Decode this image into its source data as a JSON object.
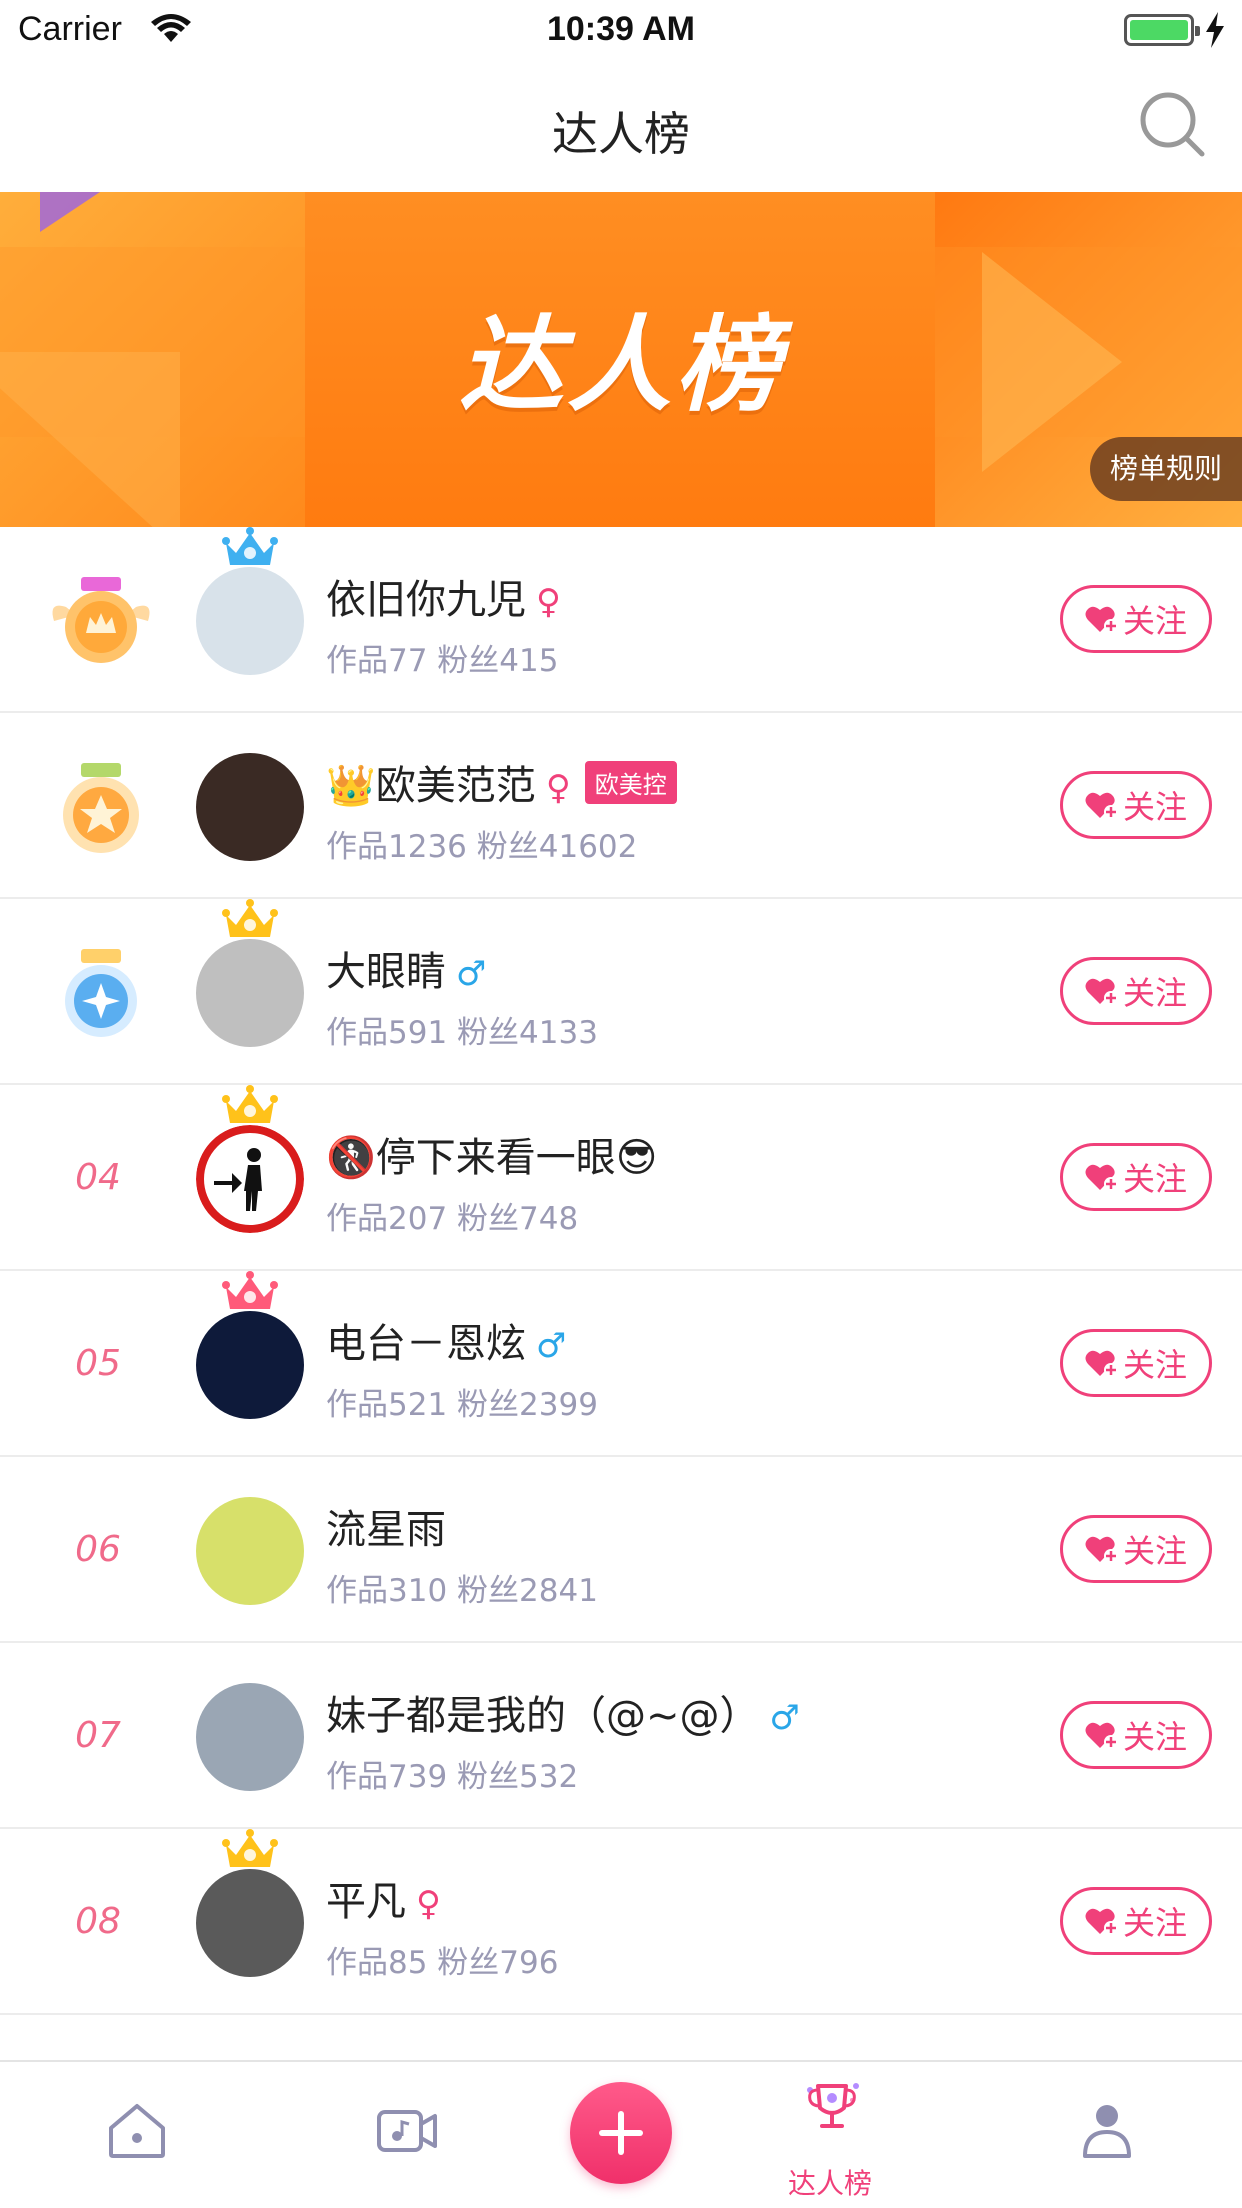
{
  "status_bar": {
    "carrier": "Carrier",
    "time": "10:39 AM"
  },
  "nav": {
    "title": "达人榜"
  },
  "banner": {
    "title": "达人榜",
    "rules_label": "榜单规则"
  },
  "rows": [
    {
      "rank": "",
      "medal": "gold-medal",
      "name": "依旧你九児",
      "gender": "♀",
      "tag": "",
      "stats": "作品77 粉丝415",
      "crown": "blue",
      "follow": "关注",
      "avatar_color": "#d8e2ea"
    },
    {
      "rank": "",
      "medal": "silver-medal",
      "name": "👑欧美范范",
      "gender": "♀",
      "tag": "欧美控",
      "stats": "作品1236 粉丝41602",
      "crown": "",
      "follow": "关注",
      "avatar_color": "#3a2a24"
    },
    {
      "rank": "",
      "medal": "bronze-medal",
      "name": "大眼睛",
      "gender": "♂",
      "tag": "",
      "stats": "作品591 粉丝4133",
      "crown": "gold",
      "follow": "关注",
      "avatar_color": "#bfbfbf"
    },
    {
      "rank": "04",
      "medal": "",
      "name": "🚷停下来看一眼😎",
      "gender": "",
      "tag": "",
      "stats": "作品207 粉丝748",
      "crown": "gold",
      "follow": "关注",
      "avatar_color": "#ffffff"
    },
    {
      "rank": "05",
      "medal": "",
      "name": "电台－恩炫",
      "gender": "♂",
      "tag": "",
      "stats": "作品521 粉丝2399",
      "crown": "pink",
      "follow": "关注",
      "avatar_color": "#0e1a3a"
    },
    {
      "rank": "06",
      "medal": "",
      "name": "流星雨",
      "gender": "",
      "tag": "",
      "stats": "作品310 粉丝2841",
      "crown": "",
      "follow": "关注",
      "avatar_color": "#d7e06a"
    },
    {
      "rank": "07",
      "medal": "",
      "name": "妹子都是我的（@~@）",
      "gender": "♂",
      "tag": "",
      "stats": "作品739 粉丝532",
      "crown": "",
      "follow": "关注",
      "avatar_color": "#9aa6b4"
    },
    {
      "rank": "08",
      "medal": "",
      "name": "平凡",
      "gender": "♀",
      "tag": "",
      "stats": "作品85 粉丝796",
      "crown": "gold",
      "follow": "关注",
      "avatar_color": "#5a5a5a"
    }
  ],
  "tab_bar": {
    "rank_label": "达人榜"
  },
  "colors": {
    "accent": "#f0407a",
    "male": "#2aa6e8",
    "banner_orange": "#ff7b10"
  }
}
